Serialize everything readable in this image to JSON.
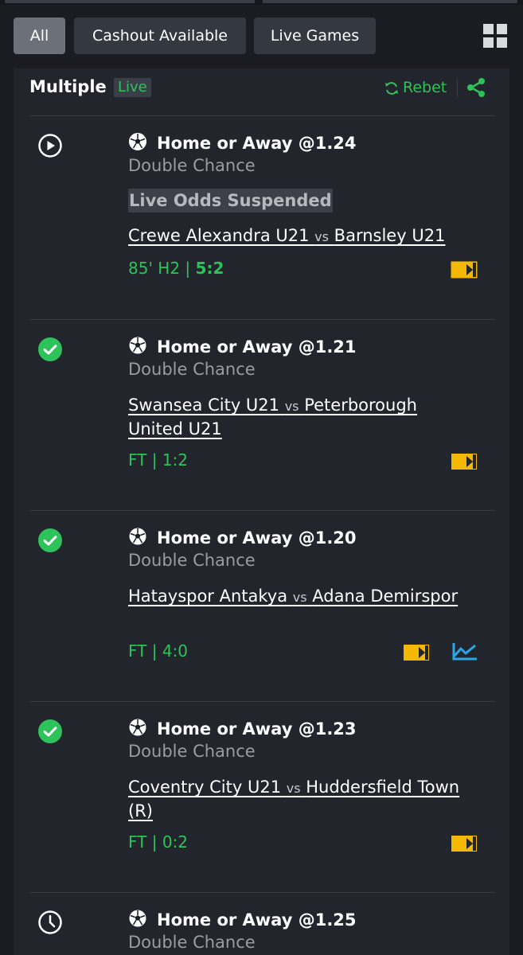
{
  "filters": {
    "all": "All",
    "cashout": "Cashout Available",
    "live": "Live Games"
  },
  "bet": {
    "type": "Multiple",
    "live_tag": "Live",
    "rebet": "Rebet"
  },
  "selections": [
    {
      "status": "live",
      "title": "Home or Away @1.24",
      "market": "Double Chance",
      "notice": "Live Odds Suspended",
      "home": "Crewe Alexandra U21",
      "vs": "vs",
      "away": "Barnsley U21",
      "score_prefix": "85' H2 | ",
      "score_value": "5:2"
    },
    {
      "status": "won",
      "title": "Home or Away @1.21",
      "market": "Double Chance",
      "home": "Swansea City U21",
      "vs": "vs",
      "away": "Peterborough United U21",
      "score_prefix": "FT | ",
      "score_value": "1:2"
    },
    {
      "status": "won",
      "title": "Home or Away @1.20",
      "market": "Double Chance",
      "home": "Hatayspor Antakya",
      "vs": "vs",
      "away": "Adana Demirspor",
      "score_prefix": "FT | ",
      "score_value": "4:0"
    },
    {
      "status": "won",
      "title": "Home or Away @1.23",
      "market": "Double Chance",
      "home": "Coventry City U21",
      "vs": "vs",
      "away": "Huddersfield Town (R)",
      "score_prefix": "FT | ",
      "score_value": "0:2"
    },
    {
      "status": "pending",
      "title": "Home or Away @1.25",
      "market": "Double Chance"
    }
  ],
  "icons": {
    "status_live": "play-circle-icon",
    "status_won": "check-circle-icon",
    "status_pending": "clock-icon",
    "sport": "soccer-ball-icon",
    "stream": "live-stream-icon",
    "stats": "stats-chart-icon",
    "rebet": "refresh-icon",
    "share": "share-icon",
    "grid": "grid-view-icon"
  },
  "colors": {
    "background": "#1a1c22",
    "card": "#23252d",
    "accent_green": "#2ec35a",
    "stream_yellow": "#f5b800",
    "stats_blue": "#2aa8e6",
    "chip_active": "#6c7079",
    "chip": "#343841"
  }
}
